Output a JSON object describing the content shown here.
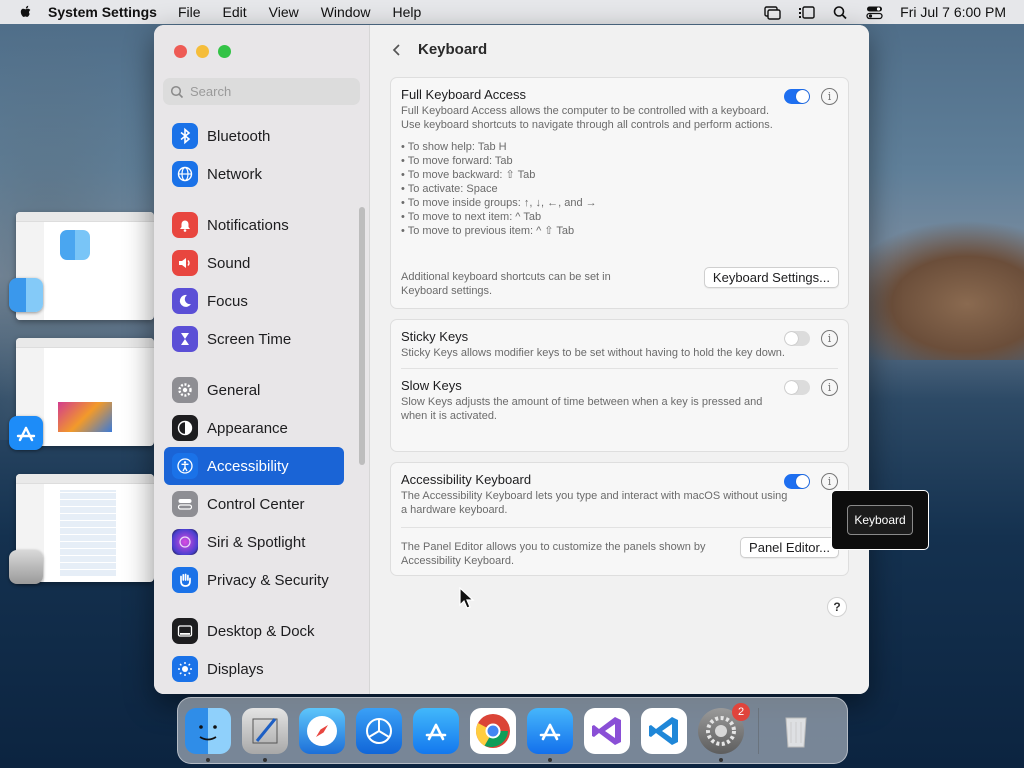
{
  "menubar": {
    "app": "System Settings",
    "items": [
      "File",
      "Edit",
      "View",
      "Window",
      "Help"
    ],
    "clock": "Fri Jul 7  6:00 PM"
  },
  "window": {
    "title": "Keyboard",
    "search_placeholder": "Search"
  },
  "sidebar": {
    "items": [
      {
        "label": "Bluetooth",
        "icon": "bluetooth-icon",
        "color": "#1a72e8"
      },
      {
        "label": "Network",
        "icon": "globe-icon",
        "color": "#1a72e8"
      },
      {
        "label": "Notifications",
        "icon": "bell-icon",
        "color": "#e8463f"
      },
      {
        "label": "Sound",
        "icon": "speaker-icon",
        "color": "#e8463f"
      },
      {
        "label": "Focus",
        "icon": "moon-icon",
        "color": "#5b4fd6"
      },
      {
        "label": "Screen Time",
        "icon": "hourglass-icon",
        "color": "#5b4fd6"
      },
      {
        "label": "General",
        "icon": "gear-icon",
        "color": "#8e8e93"
      },
      {
        "label": "Appearance",
        "icon": "appearance-icon",
        "color": "#1d1d1f"
      },
      {
        "label": "Accessibility",
        "icon": "accessibility-icon",
        "color": "#1a72e8",
        "selected": true
      },
      {
        "label": "Control Center",
        "icon": "toggles-icon",
        "color": "#8e8e93"
      },
      {
        "label": "Siri & Spotlight",
        "icon": "siri-icon",
        "color": "#b43fd0"
      },
      {
        "label": "Privacy & Security",
        "icon": "hand-icon",
        "color": "#1a72e8"
      },
      {
        "label": "Desktop & Dock",
        "icon": "dock-icon",
        "color": "#1d1d1f"
      },
      {
        "label": "Displays",
        "icon": "sun-icon",
        "color": "#1a72e8"
      }
    ]
  },
  "full_keyboard_access": {
    "title": "Full Keyboard Access",
    "description": "Full Keyboard Access allows the computer to be controlled with a keyboard. Use keyboard shortcuts to navigate through all controls and perform actions.",
    "enabled": true,
    "shortcuts": [
      "• To show help: Tab H",
      "• To move forward: Tab",
      "• To move backward: ⇧ Tab",
      "• To activate: Space",
      "• To move inside groups: ↑, ↓, ←, and →",
      "• To move to next item: ^ Tab",
      "• To move to previous item: ^ ⇧ Tab"
    ],
    "footer": "Additional keyboard shortcuts can be set in Keyboard settings.",
    "button": "Keyboard Settings..."
  },
  "sticky_keys": {
    "title": "Sticky Keys",
    "description": "Sticky Keys allows modifier keys to be set without having to hold the key down.",
    "enabled": false
  },
  "slow_keys": {
    "title": "Slow Keys",
    "description": "Slow Keys adjusts the amount of time between when a key is pressed and when it is activated.",
    "enabled": false
  },
  "accessibility_keyboard": {
    "title": "Accessibility Keyboard",
    "description": "The Accessibility Keyboard lets you type and interact with macOS without using a hardware keyboard.",
    "enabled": true,
    "panel_text": "The Panel Editor allows you to customize the panels shown by Accessibility Keyboard.",
    "button": "Panel Editor..."
  },
  "help_label": "?",
  "tooltip": "Keyboard",
  "dock": {
    "apps": [
      "Finder",
      "Preview",
      "Safari",
      "Instruments",
      "App Store",
      "Chrome",
      "Xcode Simulator",
      "Visual Studio",
      "VS Code",
      "System Settings"
    ],
    "settings_badge": "2"
  }
}
